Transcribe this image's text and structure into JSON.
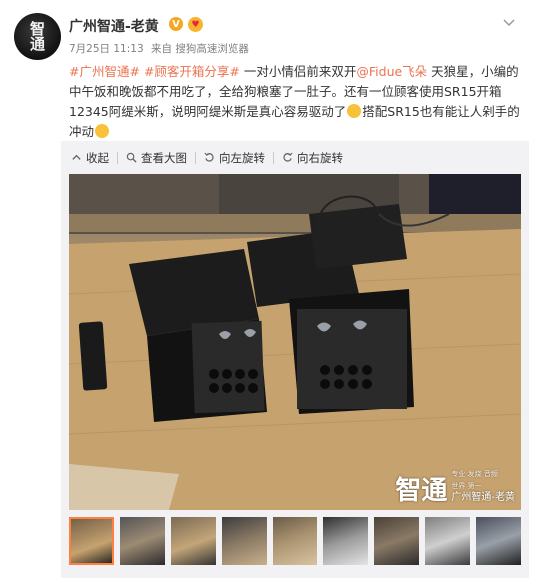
{
  "user": {
    "name": "广州智通-老黄",
    "avatar_text": "智\n通",
    "verified_mark": "V"
  },
  "meta": {
    "date": "7月25日 11:13",
    "via": "来自",
    "source": "搜狗高速浏览器"
  },
  "post": {
    "tag1": "#广州智通#",
    "tag2": "#顾客开箱分享#",
    "text1": " 一对小情侣前来双开",
    "mention": "@Fidue飞朵",
    "text2": " 天狼星，小编的中午饭和晚饭都不用吃了，全给狗粮塞了一肚子。还有一位顾客使用SR15开箱12345阿缇米斯，说明阿缇米斯是真心容易驱动了",
    "text3": "搭配SR15也有能让人剁手的冲动"
  },
  "toolbar": {
    "collect": "收起",
    "view_large": "查看大图",
    "rotate_left": "向左旋转",
    "rotate_right": "向右旋转"
  },
  "photo": {
    "watermark_logo": "智通",
    "watermark_text": "广州智通-老黄",
    "watermark_small": "专业 发烧 音频 世界 第一"
  },
  "thumbnails": {
    "count": 9,
    "active_index": 0
  },
  "colors": {
    "link": "#eb7350",
    "active_thumb": "#ff8140",
    "panel_bg": "#f2f2f5"
  }
}
